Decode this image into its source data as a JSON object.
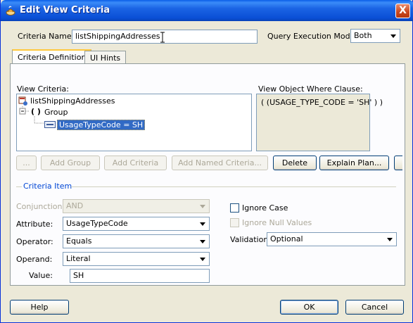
{
  "window": {
    "title": "Edit View Criteria",
    "close_label": "X"
  },
  "criteria_name": {
    "label": "Criteria Name:",
    "value": "listShippingAddresses"
  },
  "query_mode": {
    "label": "Query Execution Mode:",
    "value": "Both"
  },
  "tabs": [
    {
      "label": "Criteria Definition",
      "active": true
    },
    {
      "label": "UI Hints",
      "active": false
    }
  ],
  "view_criteria": {
    "label": "View Criteria:",
    "tree": {
      "root": "listShippingAddresses",
      "group_prefix": "( )",
      "group": "Group",
      "condition": "UsageTypeCode = SH"
    }
  },
  "where_clause": {
    "label": "View Object Where Clause:",
    "text": "( (USAGE_TYPE_CODE = 'SH' ) )"
  },
  "buttons": {
    "ellipsis": "...",
    "add_group": "Add Group",
    "add_criteria": "Add Criteria",
    "add_named_criteria": "Add Named Criteria...",
    "delete": "Delete",
    "explain_plan": "Explain Plan..."
  },
  "criteria_item": {
    "section_title": "Criteria Item",
    "conjunction": {
      "label": "Conjunction:",
      "value": "AND"
    },
    "attribute": {
      "label": "Attribute:",
      "value": "UsageTypeCode"
    },
    "operator": {
      "label": "Operator:",
      "value": "Equals"
    },
    "operand": {
      "label": "Operand:",
      "value": "Literal"
    },
    "value": {
      "label": "Value:",
      "value": "SH"
    },
    "ignore_case": "Ignore Case",
    "ignore_null": "Ignore Null Values",
    "validation": {
      "label": "Validation:",
      "value": "Optional"
    }
  },
  "footer": {
    "help": "Help",
    "ok": "OK",
    "cancel": "Cancel"
  }
}
